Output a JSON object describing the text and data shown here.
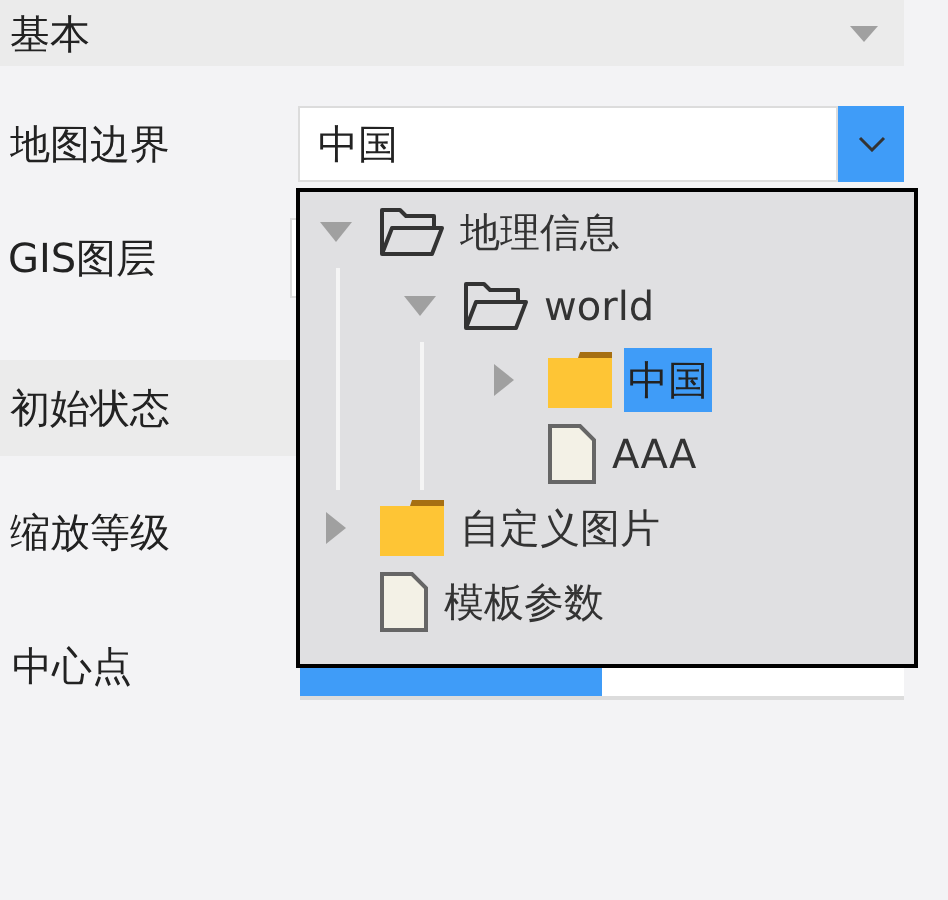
{
  "sections": [
    {
      "title": "基本",
      "expanded": true
    },
    {
      "title": "初始状态"
    }
  ],
  "fields": {
    "map_boundary": {
      "label": "地图边界",
      "value": "中国"
    },
    "gis_layer": {
      "label": "GIS图层"
    },
    "zoom_level": {
      "label": "缩放等级"
    },
    "center_point": {
      "label": "中心点",
      "options": [
        {
          "selected": true
        },
        {
          "selected": false
        }
      ]
    }
  },
  "tree": [
    {
      "label": "地理信息",
      "kind": "folder",
      "expanded": true,
      "selected": false,
      "children": [
        {
          "label": "world",
          "kind": "folder",
          "expanded": true,
          "selected": false,
          "children": [
            {
              "label": "中国",
              "kind": "folder",
              "expanded": false,
              "selected": true
            },
            {
              "label": "AAA",
              "kind": "file",
              "selected": false
            }
          ]
        }
      ]
    },
    {
      "label": "自定义图片",
      "kind": "folder",
      "expanded": false,
      "selected": false
    },
    {
      "label": "模板参数",
      "kind": "file",
      "selected": false
    }
  ]
}
